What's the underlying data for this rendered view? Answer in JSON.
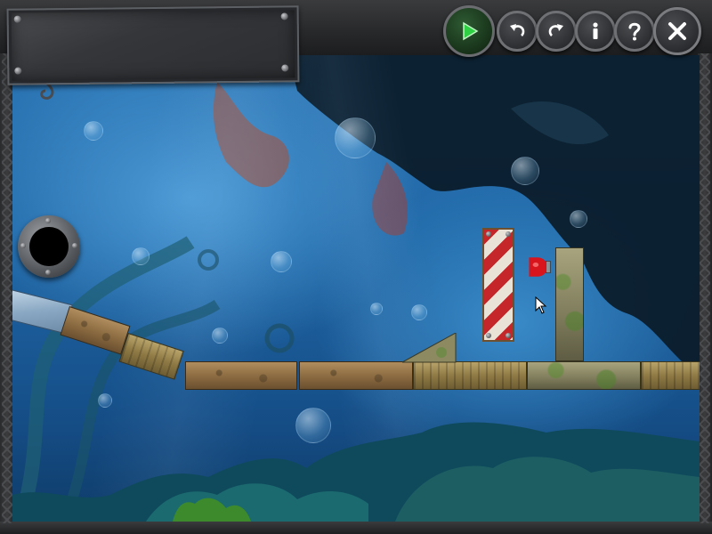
{
  "title_plate": {
    "text": ""
  },
  "toolbar": {
    "buttons": [
      {
        "id": "play",
        "icon": "play-icon",
        "color": "#27c13b"
      },
      {
        "id": "undo",
        "icon": "undo-icon"
      },
      {
        "id": "redo",
        "icon": "redo-icon"
      },
      {
        "id": "info",
        "icon": "info-icon"
      },
      {
        "id": "help",
        "icon": "help-icon"
      },
      {
        "id": "exit",
        "icon": "close-icon"
      }
    ]
  },
  "level": {
    "objects": [
      {
        "kind": "porthole",
        "material": "metal"
      },
      {
        "kind": "ramp-plank",
        "material": "ice"
      },
      {
        "kind": "ramp-plank",
        "material": "stone"
      },
      {
        "kind": "ramp-plank",
        "material": "wood"
      },
      {
        "kind": "floor-plank",
        "material": "stone"
      },
      {
        "kind": "floor-plank",
        "material": "stone"
      },
      {
        "kind": "floor-plank",
        "material": "wood"
      },
      {
        "kind": "floor-plank",
        "material": "mossy-stone"
      },
      {
        "kind": "floor-plank",
        "material": "wood"
      },
      {
        "kind": "wedge",
        "material": "mossy-stone"
      },
      {
        "kind": "hazard-block",
        "material": "red-white-stripes"
      },
      {
        "kind": "red-button",
        "material": "metal",
        "color": "#d8141c"
      },
      {
        "kind": "pillar",
        "material": "mossy-stone"
      }
    ]
  },
  "colors": {
    "water": "#1f66a5",
    "frame": "#2a2b2d",
    "accent_green": "#27c13b"
  }
}
